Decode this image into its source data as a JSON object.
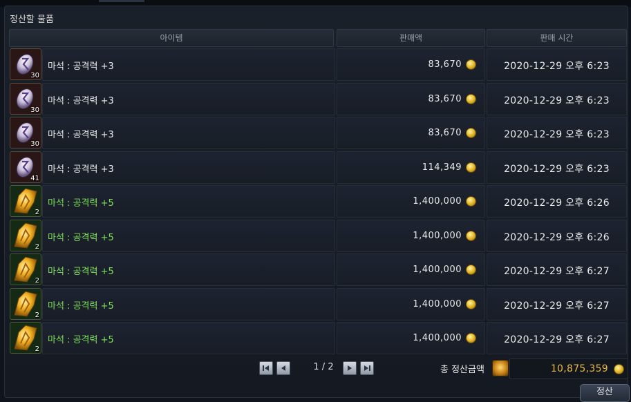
{
  "window": {
    "section_title": "정산할 물품"
  },
  "columns": {
    "item": "아이템",
    "price": "판매액",
    "time": "판매 시간"
  },
  "rows": [
    {
      "name": "마석 : 공격력 +3",
      "count": "30",
      "price": "83,670",
      "time": "2020-12-29 오후 6:23",
      "grade": "normal",
      "icon": "purple-rune-stone-icon"
    },
    {
      "name": "마석 : 공격력 +3",
      "count": "30",
      "price": "83,670",
      "time": "2020-12-29 오후 6:23",
      "grade": "normal",
      "icon": "purple-rune-stone-icon"
    },
    {
      "name": "마석 : 공격력 +3",
      "count": "30",
      "price": "83,670",
      "time": "2020-12-29 오후 6:23",
      "grade": "normal",
      "icon": "purple-rune-stone-icon"
    },
    {
      "name": "마석 : 공격력 +3",
      "count": "41",
      "price": "114,349",
      "time": "2020-12-29 오후 6:23",
      "grade": "normal",
      "icon": "purple-rune-stone-icon"
    },
    {
      "name": "마석 : 공격력 +5",
      "count": "2",
      "price": "1,400,000",
      "time": "2020-12-29 오후 6:26",
      "grade": "green",
      "icon": "gold-rune-stone-icon"
    },
    {
      "name": "마석 : 공격력 +5",
      "count": "2",
      "price": "1,400,000",
      "time": "2020-12-29 오후 6:26",
      "grade": "green",
      "icon": "gold-rune-stone-icon"
    },
    {
      "name": "마석 : 공격력 +5",
      "count": "2",
      "price": "1,400,000",
      "time": "2020-12-29 오후 6:27",
      "grade": "green",
      "icon": "gold-rune-stone-icon"
    },
    {
      "name": "마석 : 공격력 +5",
      "count": "2",
      "price": "1,400,000",
      "time": "2020-12-29 오후 6:27",
      "grade": "green",
      "icon": "gold-rune-stone-icon"
    },
    {
      "name": "마석 : 공격력 +5",
      "count": "2",
      "price": "1,400,000",
      "time": "2020-12-29 오후 6:27",
      "grade": "green",
      "icon": "gold-rune-stone-icon"
    }
  ],
  "pagination": {
    "current_page": 1,
    "total_pages": 2,
    "label": "1 / 2"
  },
  "total": {
    "label": "총 정산금액",
    "value": "10,875,359"
  },
  "settle_button": "정산",
  "colors": {
    "green_item": "#7fe05c",
    "total_value": "#e9b94a",
    "coin": "#e0b020"
  }
}
